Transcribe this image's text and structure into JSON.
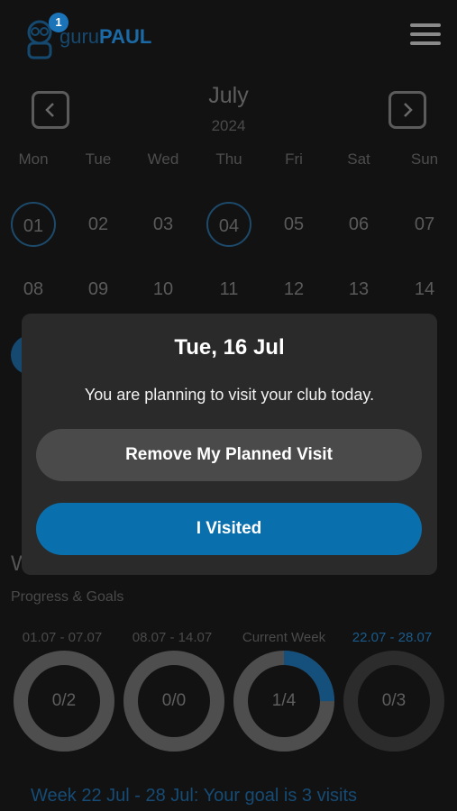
{
  "header": {
    "badge_count": "1",
    "logo_text_light": "guru",
    "logo_text_bold": "PAUL"
  },
  "calendar": {
    "month": "July",
    "year": "2024",
    "weekdays": [
      "Mon",
      "Tue",
      "Wed",
      "Thu",
      "Fri",
      "Sat",
      "Sun"
    ],
    "week1": [
      "01",
      "02",
      "03",
      "04",
      "05",
      "06",
      "07"
    ],
    "week2": [
      "08",
      "09",
      "10",
      "11",
      "12",
      "13",
      "14"
    ]
  },
  "progress": {
    "section_partial": "W",
    "title": "Progress & Goals",
    "weeks": [
      {
        "label": "01.07 - 07.07",
        "value": "0/2",
        "fraction": 0
      },
      {
        "label": "08.07 - 14.07",
        "value": "0/0",
        "fraction": 0
      },
      {
        "label": "Current Week",
        "value": "1/4",
        "fraction": 0.25
      },
      {
        "label": "22.07 - 28.07",
        "value": "0/3",
        "fraction": 0
      }
    ],
    "goal_text": "Week 22 Jul - 28 Jul: Your goal is 3 visits"
  },
  "modal": {
    "title": "Tue, 16 Jul",
    "message": "You are planning to visit your club today.",
    "remove_label": "Remove My Planned Visit",
    "visited_label": "I Visited"
  },
  "colors": {
    "accent": "#0a6fad",
    "modal_bg": "#2a2a2a",
    "secondary_button": "#4a4a4a"
  }
}
